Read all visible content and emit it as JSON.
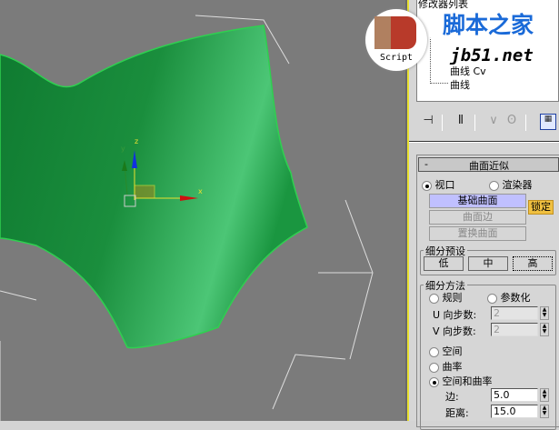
{
  "viewport": {
    "axis_x": "x",
    "axis_y": "y",
    "axis_z": "z",
    "surface_color": "#1f9a44",
    "background": "#7b7b7b"
  },
  "watermark": {
    "logo_text": "Script",
    "site_name": "脚本之家",
    "site_url": "jb51.net"
  },
  "modifier_stack": {
    "title": "修改器列表",
    "items": [
      "曲线 Cv",
      "曲线"
    ]
  },
  "toolbar": {
    "icons": [
      "pin-stack-icon",
      "show-end-result-icon",
      "make-unique-icon",
      "remove-modifier-icon",
      "configure-sets-icon"
    ]
  },
  "rollout": {
    "title": "曲面近似",
    "collapse": "-",
    "viewport_label": "视口",
    "renderer_label": "渲染器",
    "base_surface": "基础曲面",
    "surface_edge": "曲面边",
    "displacement_surface": "置换曲面",
    "lock": "锁定",
    "presets": {
      "label": "细分预设",
      "low": "低",
      "medium": "中",
      "high": "高"
    },
    "method": {
      "label": "细分方法",
      "regular": "规则",
      "parametric": "参数化",
      "u_label": "U 向步数:",
      "u_value": "2",
      "v_label": "V 向步数:",
      "v_value": "2",
      "spatial": "空间",
      "curvature": "曲率",
      "spatial_curvature": "空间和曲率",
      "edge_label": "边:",
      "edge_value": "5.0",
      "distance_label": "距离:",
      "distance_value": "15.0"
    }
  }
}
